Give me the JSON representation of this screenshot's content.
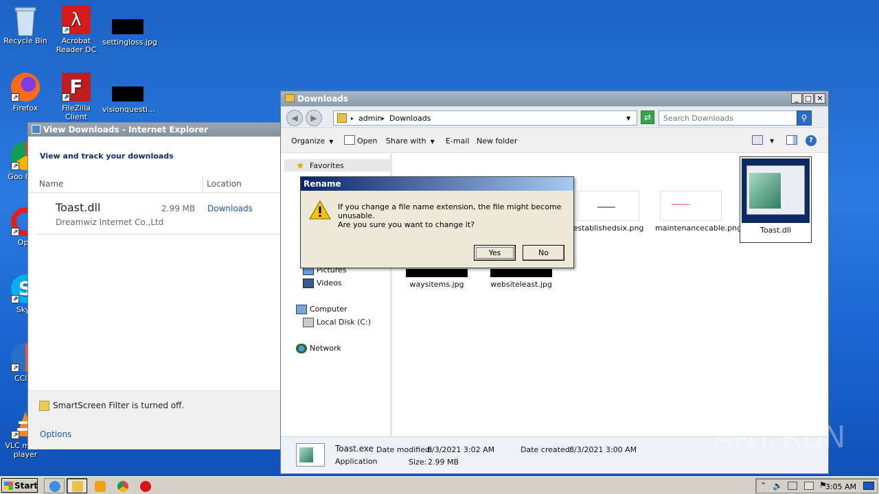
{
  "desktop": {
    "icons": [
      {
        "label": "Recycle Bin"
      },
      {
        "label": "Acrobat Reader DC"
      },
      {
        "label": "settingloss.jpg"
      },
      {
        "label": "Firefox"
      },
      {
        "label": "FileZilla Client"
      },
      {
        "label": "visionquesti..."
      },
      {
        "label": "Goo Chro"
      },
      {
        "label": "Ope"
      },
      {
        "label": "Skyp"
      },
      {
        "label": "CClea"
      },
      {
        "label": "VLC media player"
      }
    ]
  },
  "ie_window": {
    "title": "View Downloads - Internet Explorer",
    "heading": "View and track your downloads",
    "col_name": "Name",
    "col_location": "Location",
    "item": {
      "name": "Toast.dll",
      "size": "2.99 MB",
      "location": "Downloads",
      "publisher": "Dreamwiz Internet Co.,Ltd"
    },
    "smartscreen": "SmartScreen Filter is turned off.",
    "options": "Options"
  },
  "explorer": {
    "title": "Downloads",
    "breadcrumb": [
      "admin",
      "Downloads"
    ],
    "search_placeholder": "Search Downloads",
    "toolbar": {
      "organize": "Organize",
      "open": "Open",
      "share_with": "Share with",
      "email": "E-mail",
      "new_folder": "New folder"
    },
    "nav": {
      "favorites": "Favorites",
      "pictures": "Pictures",
      "videos": "Videos",
      "computer": "Computer",
      "local_disk": "Local Disk (C:)",
      "network": "Network"
    },
    "files": [
      {
        "name": "establishedsix.png"
      },
      {
        "name": "maintenancecable.png"
      },
      {
        "name": "Toast.dll"
      },
      {
        "name": "waysitems.jpg"
      },
      {
        "name": "websiteleast.jpg"
      }
    ],
    "details": {
      "filename": "Toast.exe",
      "type": "Application",
      "modified_label": "Date modified:",
      "modified": "8/3/2021 3:02 AM",
      "created_label": "Date created:",
      "created": "8/3/2021 3:00 AM",
      "size_label": "Size:",
      "size": "2.99 MB"
    }
  },
  "rename_dialog": {
    "title": "Rename",
    "message": "If you change a file name extension, the file might become unusable.",
    "question": "Are you sure you want to change it?",
    "yes": "Yes",
    "no": "No"
  },
  "taskbar": {
    "start": "Start",
    "clock": "3:05 AM"
  },
  "watermark": "ANY RUN"
}
